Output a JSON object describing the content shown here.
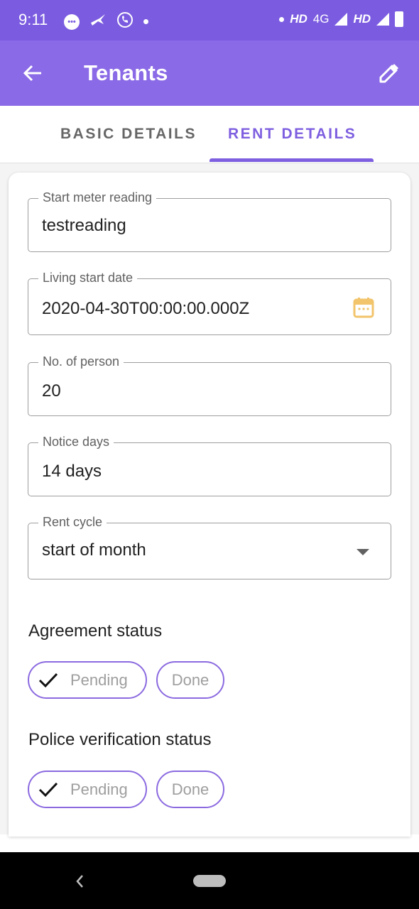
{
  "status_bar": {
    "time": "9:11",
    "network_labels": [
      "HD",
      "4G",
      "HD"
    ]
  },
  "app_bar": {
    "title": "Tenants",
    "back_icon": "arrow-left-icon",
    "edit_icon": "pencil-icon"
  },
  "tabs": [
    {
      "label": "BASIC DETAILS",
      "active": false
    },
    {
      "label": "RENT DETAILS",
      "active": true
    }
  ],
  "form": {
    "start_meter_reading": {
      "label": "Start meter reading",
      "value": "testreading"
    },
    "living_start_date": {
      "label": "Living start date",
      "value": "2020-04-30T00:00:00.000Z",
      "icon": "calendar-icon"
    },
    "no_of_person": {
      "label": "No. of person",
      "value": "20"
    },
    "notice_days": {
      "label": "Notice days",
      "value": "14 days"
    },
    "rent_cycle": {
      "label": "Rent cycle",
      "value": "start of month",
      "icon": "dropdown-caret-icon"
    }
  },
  "agreement_status": {
    "title": "Agreement status",
    "options": [
      {
        "label": "Pending",
        "selected": true
      },
      {
        "label": "Done",
        "selected": false
      }
    ]
  },
  "police_verification_status": {
    "title": "Police verification status",
    "options": [
      {
        "label": "Pending",
        "selected": true
      },
      {
        "label": "Done",
        "selected": false
      }
    ]
  },
  "colors": {
    "primary": "#8a6ae6",
    "status_bar": "#7b5ce0",
    "accent": "#7e5fe0",
    "calendar_icon": "#f2c46b"
  }
}
